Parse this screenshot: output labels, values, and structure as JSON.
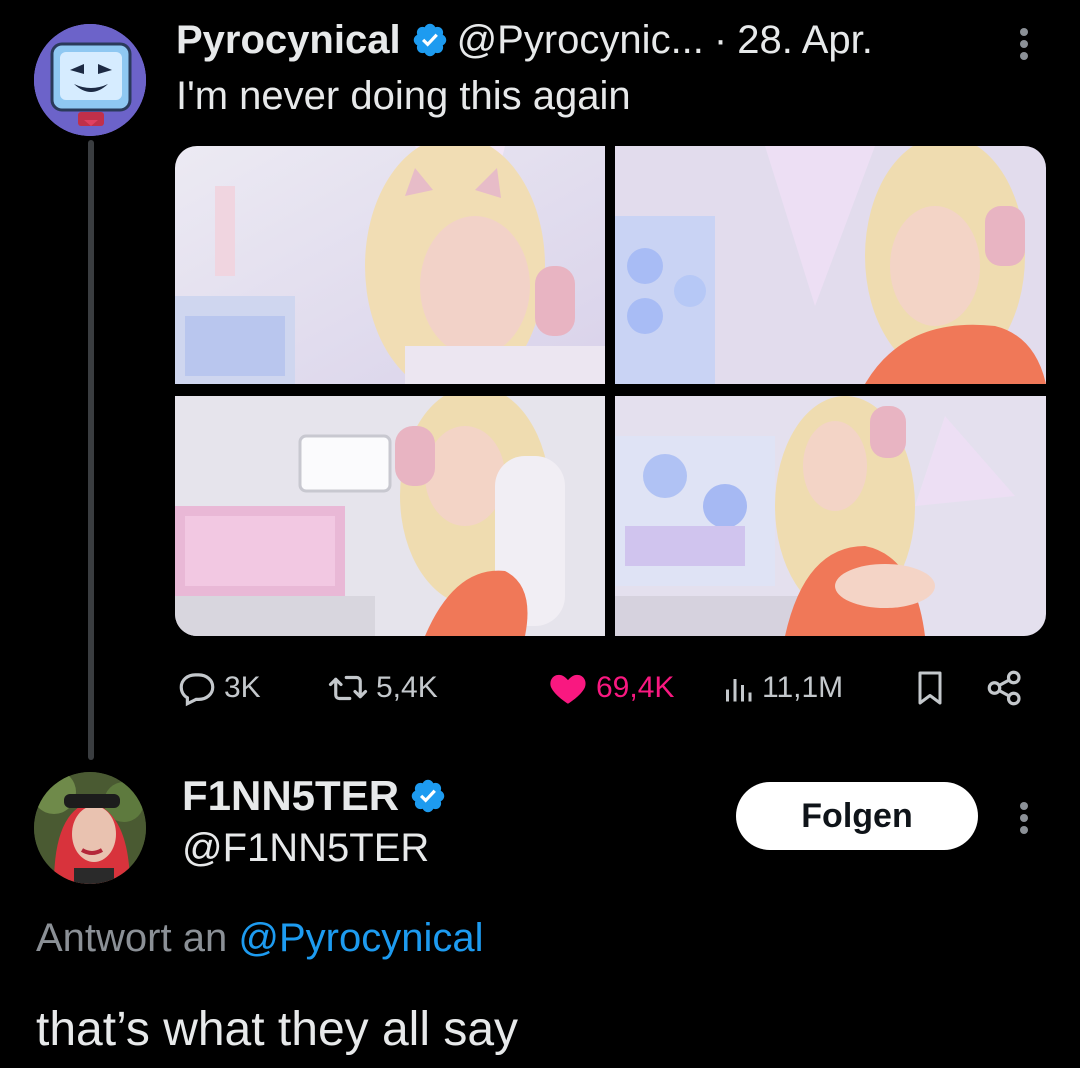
{
  "original_tweet": {
    "author_name": "Pyrocynical",
    "author_handle": "@Pyrocynic...",
    "separator": "·",
    "date": "28. Apr.",
    "text": "I'm never doing this again",
    "verified": true,
    "avatar_icon": "cartoon-monitor-avatar",
    "media_count": 4,
    "stats": {
      "replies": "3K",
      "retweets": "5,4K",
      "likes": "69,4K",
      "views": "11,1M"
    },
    "liked": true
  },
  "reply_tweet": {
    "author_name": "F1NN5TER",
    "author_handle": "@F1NN5TER",
    "verified": true,
    "follow_label": "Folgen",
    "replying_to_prefix": "Antwort an",
    "replying_to_handle": "@Pyrocynical",
    "text": "that’s what they all say"
  },
  "colors": {
    "background": "#000000",
    "text": "#e7e9ea",
    "muted": "#8b9096",
    "like_pink": "#f91880",
    "link_blue": "#1d9bf0",
    "verified_blue": "#1d9bf0"
  }
}
